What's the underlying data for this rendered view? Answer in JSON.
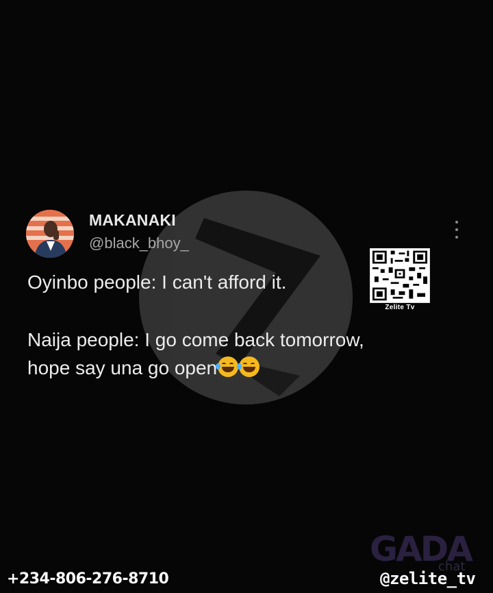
{
  "tweet": {
    "display_name": "MAKANAKI",
    "handle": "@black_bhoy_",
    "line1": "Oyinbo people: I can't afford it.",
    "line2": "Naija people: I go come back tomorrow,",
    "line3": "hope say una go open"
  },
  "icons": {
    "emoji": "face-with-tears-of-joy-icon",
    "menu": "more-options-icon"
  },
  "qr": {
    "label": "Zelite Tv"
  },
  "watermarks": {
    "gada_logo": "GADA",
    "gada_sub": "chat"
  },
  "footer": {
    "phone": "+234-806-276-8710",
    "brand_handle": "@zelite_tv"
  },
  "colors": {
    "background": "#060606",
    "avatar_bg": "#d5603f",
    "emoji": "#f5b81f"
  }
}
